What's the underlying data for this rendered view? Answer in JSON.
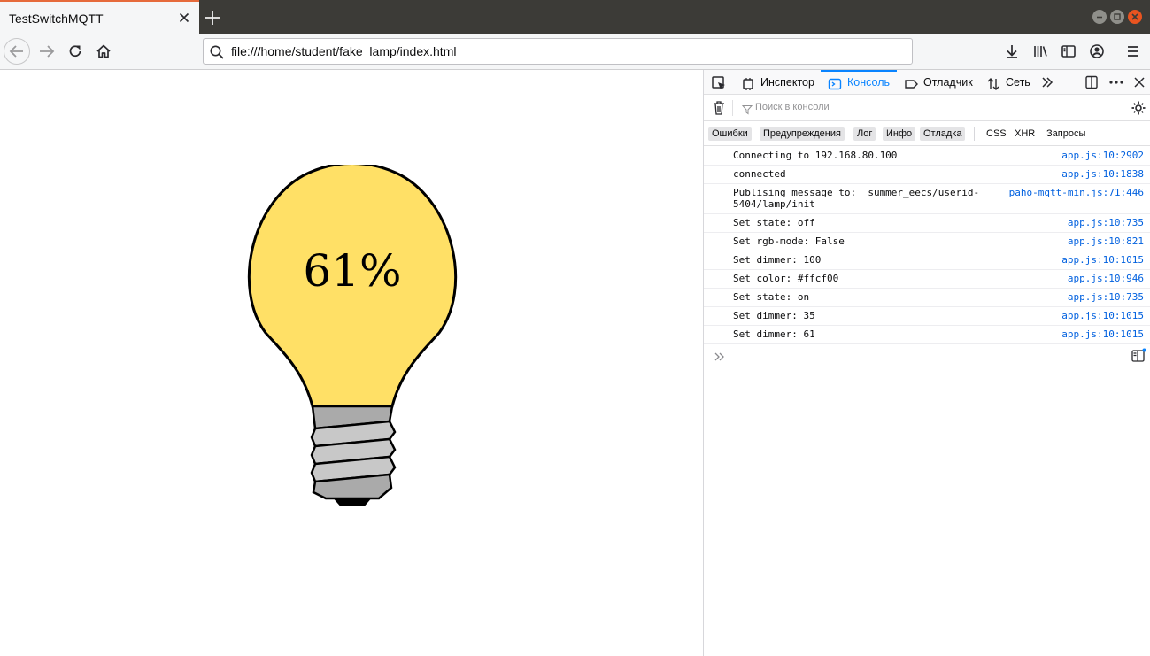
{
  "browser": {
    "tab_title": "TestSwitchMQTT",
    "url": "file:///home/student/fake_lamp/index.html"
  },
  "page": {
    "lamp": {
      "brightness_text": "61%",
      "brightness_percent": 61,
      "bulb_color": "#ffe066"
    }
  },
  "devtools": {
    "tabs": {
      "inspector": "Инспектор",
      "console": "Консоль",
      "debugger": "Отладчик",
      "network": "Сеть"
    },
    "active_tab": "console",
    "accent_color": "#0a84ff",
    "filter_placeholder": "Поиск в консоли",
    "levels": {
      "errors": "Ошибки",
      "warnings": "Предупреждения",
      "log": "Лог",
      "info": "Инфо",
      "debug": "Отладка",
      "css": "CSS",
      "xhr": "XHR",
      "requests": "Запросы"
    },
    "messages": [
      {
        "text": "Connecting to 192.168.80.100",
        "source": "app.js:10:2902"
      },
      {
        "text": "connected",
        "source": "app.js:10:1838"
      },
      {
        "text": "Publising message to:  summer_eecs/userid-\n5404/lamp/init",
        "source": "paho-mqtt-min.js:71:446"
      },
      {
        "text": "Set state: off",
        "source": "app.js:10:735"
      },
      {
        "text": "Set rgb-mode: False",
        "source": "app.js:10:821"
      },
      {
        "text": "Set dimmer: 100",
        "source": "app.js:10:1015"
      },
      {
        "text": "Set color: #ffcf00",
        "source": "app.js:10:946"
      },
      {
        "text": "Set state: on",
        "source": "app.js:10:735"
      },
      {
        "text": "Set dimmer: 35",
        "source": "app.js:10:1015"
      },
      {
        "text": "Set dimmer: 61",
        "source": "app.js:10:1015"
      }
    ]
  }
}
